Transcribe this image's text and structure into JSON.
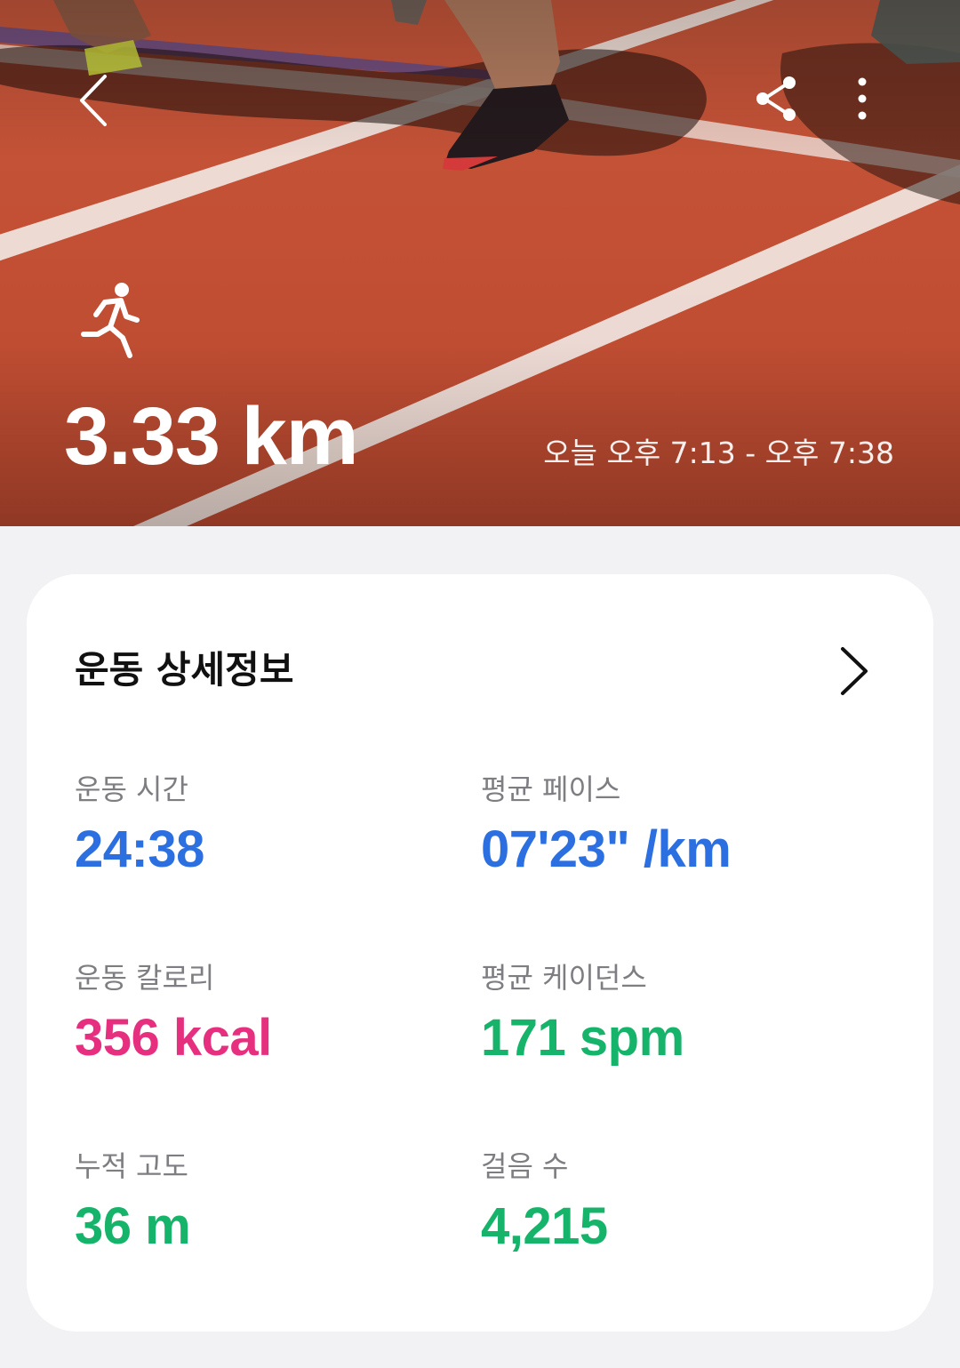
{
  "hero": {
    "distance": "3.33 km",
    "time_range": "오늘 오후 7:13 - 오후 7:38",
    "icons": {
      "back": "back-chevron-icon",
      "share": "share-icon",
      "more": "more-vertical-icon",
      "activity": "running-icon"
    }
  },
  "details": {
    "title": "운동 상세정보",
    "stats": [
      {
        "label": "운동 시간",
        "value": "24:38",
        "color": "#2b6fe0"
      },
      {
        "label": "평균 페이스",
        "value": "07'23\" /km",
        "color": "#2b6fe0"
      },
      {
        "label": "운동 칼로리",
        "value": "356 kcal",
        "color": "#e6307f"
      },
      {
        "label": "평균 케이던스",
        "value": "171 spm",
        "color": "#16b36a"
      },
      {
        "label": "누적 고도",
        "value": "36 m",
        "color": "#16b36a"
      },
      {
        "label": "걸음 수",
        "value": "4,215",
        "color": "#16b36a"
      }
    ]
  },
  "colors": {
    "background": "#f2f2f4",
    "card": "#ffffff",
    "track": "#c4553a"
  }
}
